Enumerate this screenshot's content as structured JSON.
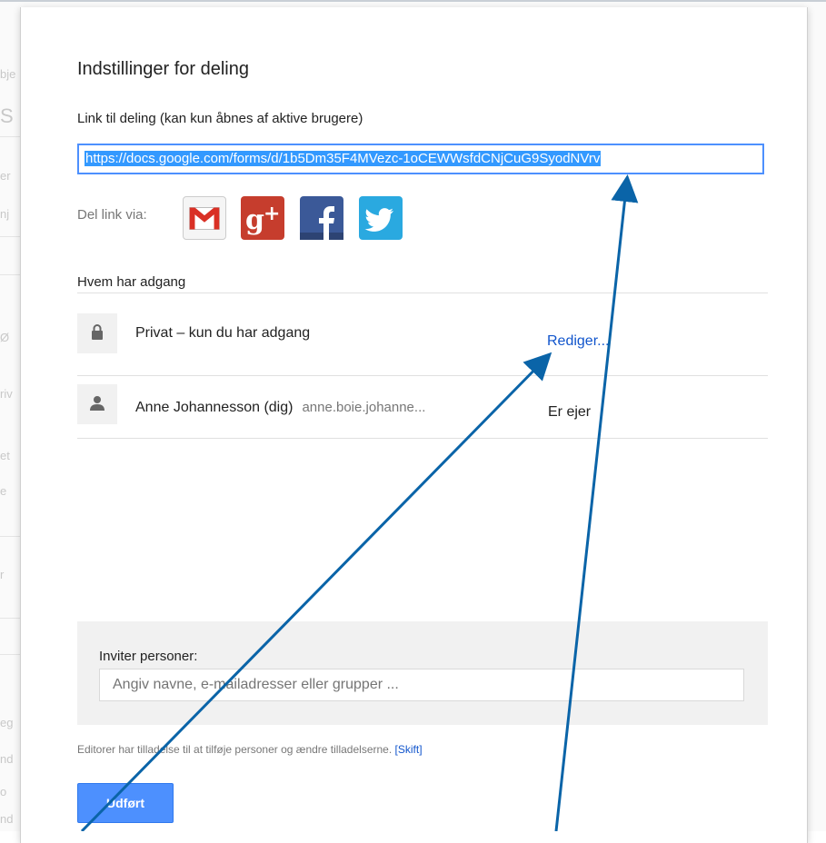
{
  "background": {
    "fragments": [
      "bje",
      "S",
      "er",
      "nj",
      "Ø",
      "riv",
      "et",
      "e",
      "r",
      "eg",
      "nd",
      "o",
      "nd"
    ]
  },
  "dialog": {
    "title": "Indstillinger for deling",
    "link_section": {
      "label": "Link til deling (kan kun åbnes af aktive brugere)",
      "url": "https://docs.google.com/forms/d/1b5Dm35F4MVezc-1oCEWWsfdCNjCuG9SyodNVrv"
    },
    "share_via": {
      "label": "Del link via:",
      "icons": [
        "gmail-icon",
        "google-plus-icon",
        "facebook-icon",
        "twitter-icon"
      ]
    },
    "access": {
      "title": "Hvem har adgang",
      "rows": [
        {
          "icon": "lock-icon",
          "text": "Privat – kun du har adgang",
          "action": "Rediger..."
        },
        {
          "icon": "person-icon",
          "name": "Anne Johannesson (dig)",
          "email": "anne.boie.johanne...",
          "role": "Er ejer"
        }
      ]
    },
    "invite": {
      "label": "Inviter personer:",
      "placeholder": "Angiv navne, e-mailadresser eller grupper ..."
    },
    "footnote": {
      "text": "Editorer har tilladelse til at tilføje personer og ændre tilladelserne.",
      "link": "[Skift]"
    },
    "done_button": "Udført"
  },
  "colors": {
    "accent": "#4d90fe",
    "link": "#1155cc",
    "selection": "#3399ff",
    "annotation_arrow": "#0a64a8"
  }
}
